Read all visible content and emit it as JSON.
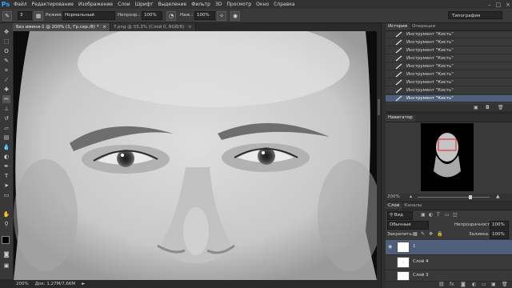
{
  "menubar": {
    "logo": "Ps",
    "items": [
      "Файл",
      "Редактирование",
      "Изображение",
      "Слои",
      "Шрифт",
      "Выделение",
      "Фильтр",
      "3D",
      "Просмотр",
      "Окно",
      "Справка"
    ],
    "window_controls": [
      "–",
      "□",
      "×"
    ]
  },
  "options": {
    "size_value": "3",
    "mode_label": "Режим:",
    "mode_value": "Нормальный",
    "opacity_label": "Непрозр.:",
    "opacity_value": "100%",
    "pressure_label": "Наж.:",
    "pressure_value": "100%",
    "workspace": "Типография"
  },
  "tabs": [
    {
      "label": "Без имени-1 @ 200% (1, Гр.сер./8) *",
      "close": "×"
    },
    {
      "label": "7.png @ 33,3% (Слой 0, RGB/8)",
      "close": "×"
    }
  ],
  "status": {
    "zoom": "200%",
    "doc": "Док: 1,27М/7,66М"
  },
  "history": {
    "tabs": [
      "История",
      "Операции"
    ],
    "item_label": "Инструмент \"Кисть\"",
    "rows": 9,
    "active_row": 8
  },
  "navigator": {
    "tabs": [
      "Навигатор"
    ],
    "zoom": "200%"
  },
  "layers": {
    "tabs": [
      "Слои",
      "Каналы"
    ],
    "filter_value": "Вид",
    "blend_mode": "Обычные",
    "opacity_label": "Непрозрачность:",
    "opacity_value": "100%",
    "lock_label": "Закрепить:",
    "fill_label": "Заливка:",
    "fill_value": "100%",
    "items": [
      {
        "name": "1",
        "active": true
      },
      {
        "name": "Слой 4",
        "active": false
      },
      {
        "name": "Слой 3",
        "active": false
      }
    ]
  },
  "colors": {
    "ps_blue": "#31a8ff",
    "active_row": "#4d5f7a",
    "navigator_frame": "#e02020"
  }
}
